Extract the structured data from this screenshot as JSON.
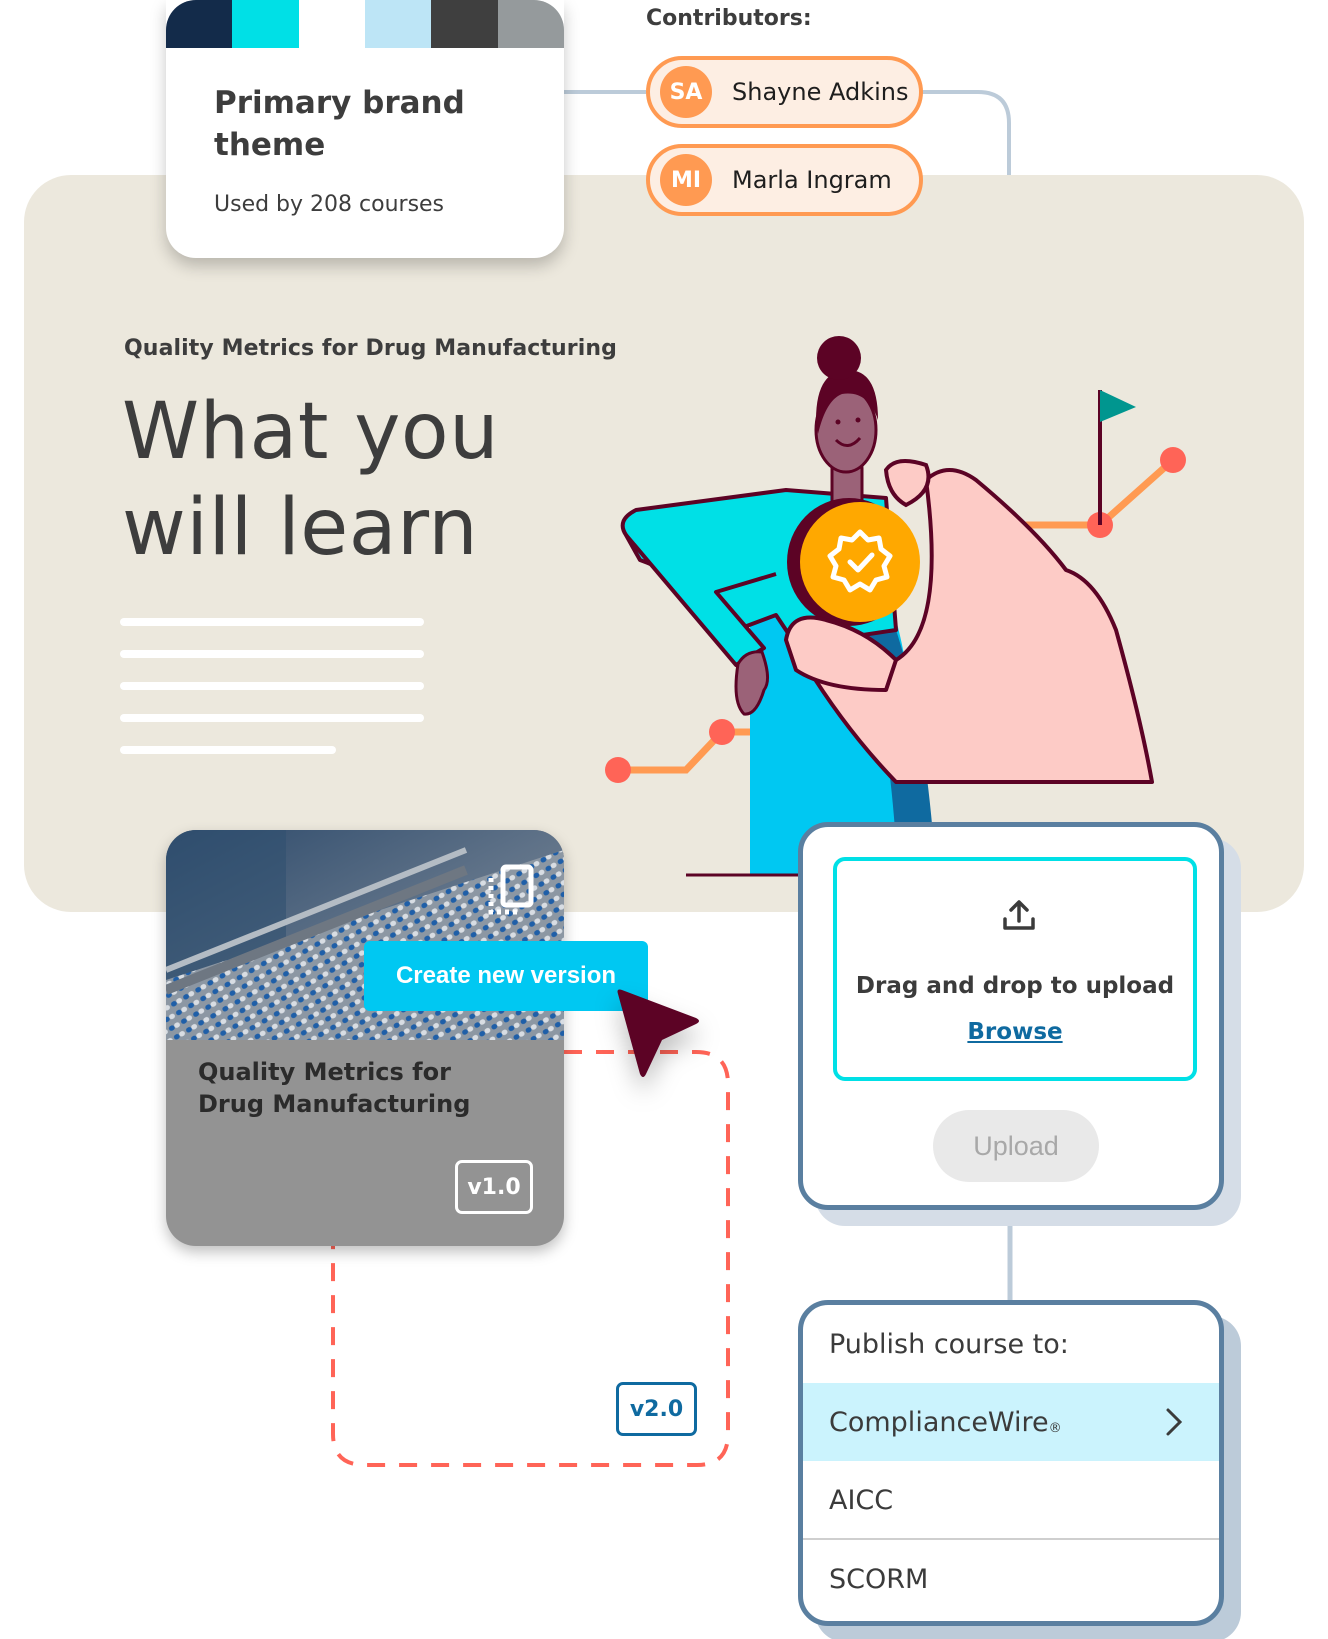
{
  "theme_card": {
    "title": "Primary brand theme",
    "usage": "Used by 208 courses",
    "swatches": [
      "#132b4a",
      "#00e0e6",
      "#ffffff",
      "#bde5f6",
      "#3f3f3f",
      "#959a9c"
    ]
  },
  "contributors": {
    "label": "Contributors:",
    "people": [
      {
        "initials": "SA",
        "name": "Shayne Adkins"
      },
      {
        "initials": "MI",
        "name": "Marla Ingram"
      }
    ]
  },
  "hero": {
    "subtitle": "Quality Metrics for Drug Manufacturing",
    "title_line1": "What you",
    "title_line2": "will learn"
  },
  "course_card": {
    "title": "Quality Metrics for Drug Manufacturing",
    "version": "v1.0",
    "icon": "version-copy-icon",
    "create_button": "Create new version",
    "new_version": "v2.0"
  },
  "upload": {
    "icon": "upload-icon",
    "drop_text": "Drag and drop to upload",
    "browse_label": "Browse",
    "upload_button": "Upload"
  },
  "publish": {
    "title": "Publish course to:",
    "options": [
      {
        "label": "ComplianceWire",
        "mark": "®",
        "selected": true
      },
      {
        "label": "AICC",
        "selected": false
      },
      {
        "label": "SCORM",
        "selected": false
      }
    ]
  },
  "colors": {
    "hero_bg": "#ece8dd",
    "accent_cyan": "#00c8f2",
    "accent_orange": "#ff9a52",
    "card_border": "#5a7fa0",
    "link_blue": "#0f6aa0",
    "cursor": "#5c0325",
    "dashed_path": "#ff6457"
  }
}
